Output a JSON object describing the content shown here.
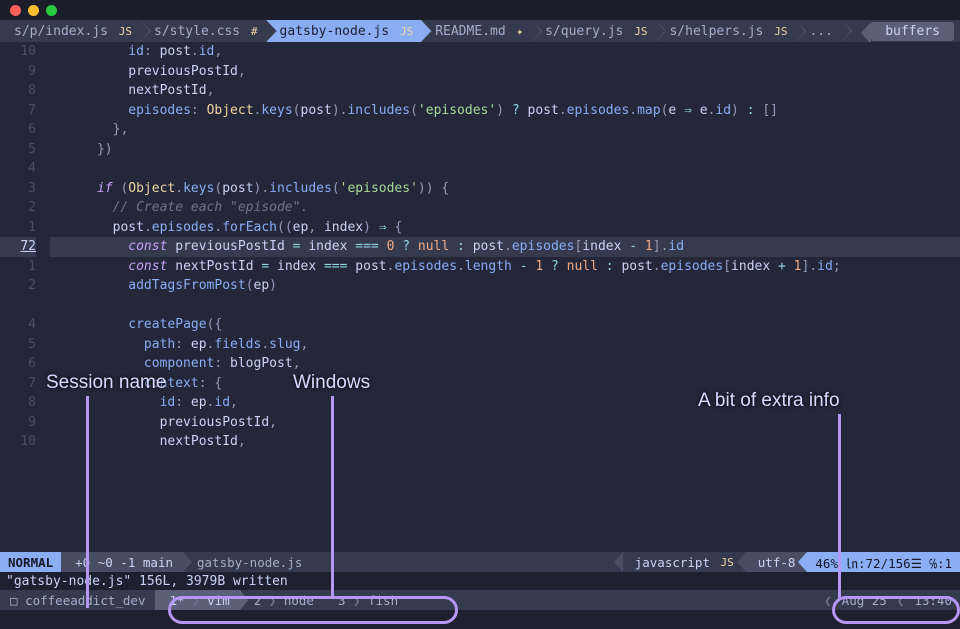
{
  "tabs": [
    {
      "label": "s/p/index.js",
      "suffix": "JS"
    },
    {
      "label": "s/style.css",
      "suffix": "#"
    },
    {
      "label": "gatsby-node.js",
      "suffix": "JS"
    },
    {
      "label": "README.md",
      "suffix": "✦"
    },
    {
      "label": "s/query.js",
      "suffix": "JS"
    },
    {
      "label": "s/helpers.js",
      "suffix": "JS"
    },
    {
      "label": "...",
      "suffix": ""
    }
  ],
  "active_tab_index": 2,
  "buffers_label": "buffers",
  "gutter": [
    "10",
    "9",
    "8",
    "7",
    "6",
    "5",
    "4",
    "3",
    "2",
    "1",
    "72",
    "1",
    "2",
    "",
    "4",
    "5",
    "6",
    "7",
    "8",
    "9",
    "10"
  ],
  "current_line_index": 10,
  "code_html": [
    "      <span class='c-prop'>id</span><span class='c-punc'>:</span> <span class='c-var'>post</span><span class='c-punc'>.</span><span class='c-prop'>id</span><span class='c-punc'>,</span>",
    "      <span class='c-var'>previousPostId</span><span class='c-punc'>,</span>",
    "      <span class='c-var'>nextPostId</span><span class='c-punc'>,</span>",
    "      <span class='c-prop'>episodes</span><span class='c-punc'>:</span> <span class='c-obj'>Object</span><span class='c-punc'>.</span><span class='c-func'>keys</span><span class='c-punc'>(</span><span class='c-var'>post</span><span class='c-punc'>).</span><span class='c-func'>includes</span><span class='c-punc'>(</span><span class='c-str'>'episodes'</span><span class='c-punc'>)</span> <span class='c-op'>?</span> <span class='c-var'>post</span><span class='c-punc'>.</span><span class='c-prop'>episodes</span><span class='c-punc'>.</span><span class='c-func'>map</span><span class='c-punc'>(</span><span class='c-var'>e</span> <span class='c-op'>⇒</span> <span class='c-var'>e</span><span class='c-punc'>.</span><span class='c-prop'>id</span><span class='c-punc'>)</span> <span class='c-op'>:</span> <span class='c-punc'>[]</span>",
    "    <span class='c-punc'>},</span>",
    "  <span class='c-punc'>})</span>",
    "",
    "  <span class='c-kw'>if</span> <span class='c-punc'>(</span><span class='c-obj'>Object</span><span class='c-punc'>.</span><span class='c-func'>keys</span><span class='c-punc'>(</span><span class='c-var'>post</span><span class='c-punc'>).</span><span class='c-func'>includes</span><span class='c-punc'>(</span><span class='c-str'>'episodes'</span><span class='c-punc'>))</span> <span class='c-punc'>{</span>",
    "    <span class='c-comm'>// Create each \"episode\".</span>",
    "    <span class='c-var'>post</span><span class='c-punc'>.</span><span class='c-prop'>episodes</span><span class='c-punc'>.</span><span class='c-func'>forEach</span><span class='c-punc'>((</span><span class='c-var'>ep</span><span class='c-punc'>,</span> <span class='c-var'>index</span><span class='c-punc'>)</span> <span class='c-op'>⇒</span> <span class='c-punc'>{</span>",
    "      <span class='c-kw'>const</span> <span class='c-var'>previousPostId</span> <span class='c-op'>=</span> <span class='c-var'>index</span> <span class='c-op'>===</span> <span class='c-num'>0</span> <span class='c-op'>?</span> <span class='c-num'>null</span> <span class='c-op'>:</span> <span class='c-var'>post</span><span class='c-punc'>.</span><span class='c-prop'>episodes</span><span class='c-punc'>[</span><span class='c-var'>index</span> <span class='c-op'>-</span> <span class='c-num'>1</span><span class='c-punc'>].</span><span class='c-prop'>id</span>",
    "      <span class='c-kw'>const</span> <span class='c-var'>nextPostId</span> <span class='c-op'>=</span> <span class='c-var'>index</span> <span class='c-op'>===</span> <span class='c-var'>post</span><span class='c-punc'>.</span><span class='c-prop'>episodes</span><span class='c-punc'>.</span><span class='c-prop'>length</span> <span class='c-op'>-</span> <span class='c-num'>1</span> <span class='c-op'>?</span> <span class='c-num'>null</span> <span class='c-op'>:</span> <span class='c-var'>post</span><span class='c-punc'>.</span><span class='c-prop'>episodes</span><span class='c-punc'>[</span><span class='c-var'>index</span> <span class='c-op'>+</span> <span class='c-num'>1</span><span class='c-punc'>].</span><span class='c-prop'>id</span><span class='c-punc'>;</span>",
    "      <span class='c-func'>addTagsFromPost</span><span class='c-punc'>(</span><span class='c-var'>ep</span><span class='c-punc'>)</span>",
    "",
    "      <span class='c-func'>createPage</span><span class='c-punc'>({</span>",
    "        <span class='c-prop'>path</span><span class='c-punc'>:</span> <span class='c-var'>ep</span><span class='c-punc'>.</span><span class='c-prop'>fields</span><span class='c-punc'>.</span><span class='c-prop'>slug</span><span class='c-punc'>,</span>",
    "        <span class='c-prop'>component</span><span class='c-punc'>:</span> <span class='c-var'>blogPost</span><span class='c-punc'>,</span>",
    "        <span class='c-prop'>context</span><span class='c-punc'>:</span> <span class='c-punc'>{</span>",
    "          <span class='c-prop'>id</span><span class='c-punc'>:</span> <span class='c-var'>ep</span><span class='c-punc'>.</span><span class='c-prop'>id</span><span class='c-punc'>,</span>",
    "          <span class='c-var'>previousPostId</span><span class='c-punc'>,</span>",
    "          <span class='c-var'>nextPostId</span><span class='c-punc'>,</span>"
  ],
  "statusline": {
    "mode": "NORMAL",
    "git": "+0 ~0 -1  main ",
    "filename": "gatsby-node.js",
    "filetype": "javascript",
    "filetype_badge": "JS",
    "encoding": "utf-8 ",
    "position": "46% ㏑:72/156☰ ℅:1"
  },
  "message": "\"gatsby-node.js\" 156L, 3979B written",
  "tmux": {
    "session_icon": "□",
    "session": "coffeeaddict_dev",
    "windows": [
      {
        "index": "1*",
        "name": "vim",
        "active": true
      },
      {
        "index": "2",
        "name": "node",
        "active": false
      },
      {
        "index": "3",
        "name": "fish",
        "active": false
      }
    ],
    "date": "Aug 25",
    "time": "13:40"
  },
  "annotations": {
    "session": "Session name",
    "windows": "Windows",
    "extra": "A bit of extra info"
  }
}
